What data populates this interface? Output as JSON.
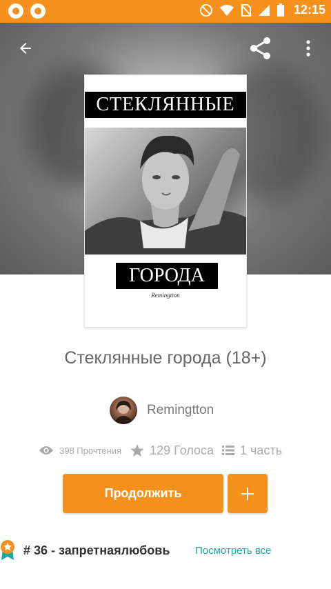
{
  "status_bar": {
    "time": "12:15",
    "color": "#f6911e"
  },
  "header": {
    "back_icon": "arrow-left-icon",
    "share_icon": "share-icon",
    "more_icon": "more-vert-icon"
  },
  "cover": {
    "title_line1": "СТЕКЛЯННЫЕ",
    "title_line2": "ГОРОДА",
    "signature": "Remingtton"
  },
  "story": {
    "title": "Стеклянные города (18+)",
    "author": "Remingtton"
  },
  "stats": {
    "reads": "398 Прочтения",
    "votes": "129 Голоса",
    "parts": "1 часть"
  },
  "actions": {
    "continue_label": "Продолжить",
    "add_label": "+",
    "accent": "#f6911e"
  },
  "ranking": {
    "text": "# 36 - запретнаялюбовь",
    "view_all": "Посмотреть все",
    "link_color": "#1aa9a5"
  }
}
